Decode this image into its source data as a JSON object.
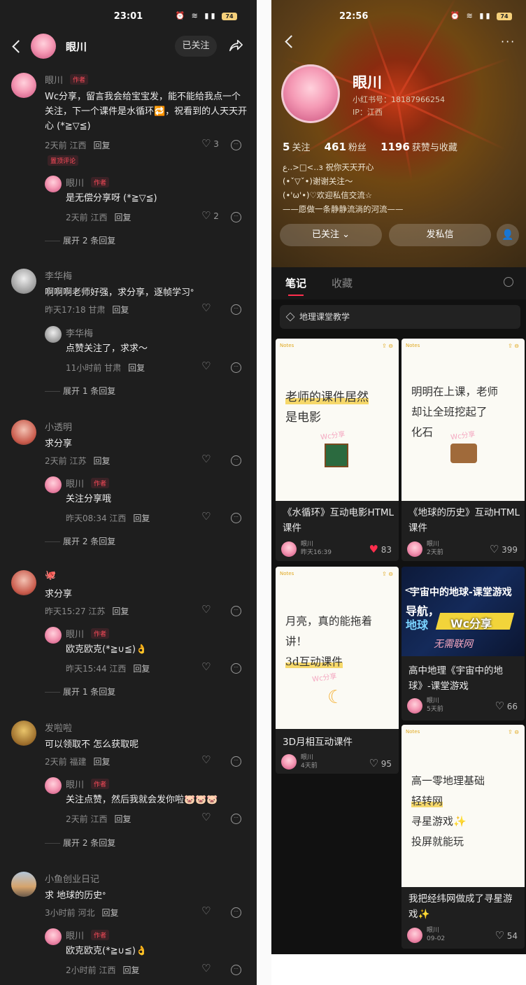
{
  "left": {
    "status": {
      "time": "23:01",
      "battery": "74"
    },
    "header": {
      "name": "眼川",
      "follow": "已关注"
    },
    "comments": [
      {
        "name": "眼川",
        "author_tag": "作者",
        "text": "Wc分享，留言我会给宝宝发，能不能给我点一个关注，下一个课件是水循环🔁，祝看到的人天天开心 (*≧▽≦)",
        "time": "2天前 江西",
        "reply": "回复",
        "likes": "3",
        "pinned": "置顶评论",
        "replies": [
          {
            "name": "眼川",
            "author_tag": "作者",
            "text": "是无偿分享呀 (*≧▽≦)",
            "time": "2天前 江西",
            "reply": "回复",
            "likes": "2"
          }
        ],
        "expand": "展开 2 条回复"
      },
      {
        "name": "李华梅",
        "text": "啊啊啊老师好强，求分享，逐帧学习ᐤ",
        "time": "昨天17:18 甘肃",
        "reply": "回复",
        "likes": "",
        "replies": [
          {
            "name": "李华梅",
            "text": "点赞关注了，求求～",
            "time": "11小时前 甘肃",
            "reply": "回复",
            "likes": ""
          }
        ],
        "expand": "展开 1 条回复"
      },
      {
        "name": "小透明",
        "text": "求分享",
        "time": "2天前 江苏",
        "reply": "回复",
        "likes": "",
        "replies": [
          {
            "name": "眼川",
            "author_tag": "作者",
            "text": "关注分享哦",
            "time": "昨天08:34 江西",
            "reply": "回复",
            "likes": ""
          }
        ],
        "expand": "展开 2 条回复"
      },
      {
        "name": "🐙",
        "text": "求分享",
        "time": "昨天15:27 江苏",
        "reply": "回复",
        "likes": "",
        "replies": [
          {
            "name": "眼川",
            "author_tag": "作者",
            "text": "欧克欧克(*≧∪≦)👌",
            "time": "昨天15:44 江西",
            "reply": "回复",
            "likes": ""
          }
        ],
        "expand": "展开 1 条回复"
      },
      {
        "name": "发啦啦",
        "text": "可以领取不 怎么获取呢",
        "time": "2天前 福建",
        "reply": "回复",
        "likes": "",
        "replies": [
          {
            "name": "眼川",
            "author_tag": "作者",
            "text": "关注点赞，然后我就会发你啦🐷🐷🐷",
            "time": "2天前 江西",
            "reply": "回复",
            "likes": ""
          }
        ],
        "expand": "展开 2 条回复"
      },
      {
        "name": "小鱼创业日记",
        "text": "求 地球的历史ᐤ",
        "time": "3小时前 河北",
        "reply": "回复",
        "likes": "",
        "replies": [
          {
            "name": "眼川",
            "author_tag": "作者",
            "text": "欧克欧克(*≧∪≦)👌",
            "time": "2小时前 江西",
            "reply": "回复",
            "likes": ""
          }
        ]
      }
    ]
  },
  "right": {
    "status": {
      "time": "22:56",
      "battery": "74"
    },
    "profile": {
      "name": "眼川",
      "id": "小红书号：18187966254",
      "ip": "IP：江西",
      "following": "5",
      "following_label": "关注",
      "fans": "461",
      "fans_label": "粉丝",
      "likes": "1196",
      "likes_label": "获赞与收藏",
      "bio": [
        "ع..>□<..з 祝你天天开心",
        "(•ˇ▽ˇ•)谢谢关注～",
        "(•'ω'•)♡欢迎私信交流☆",
        "——愿做一条静静流淌的河流——"
      ],
      "follow_btn": "已关注 ⌄",
      "message_btn": "发私信"
    },
    "tabs": [
      "笔记",
      "收藏"
    ],
    "collection": "地理课堂教学",
    "notes": [
      {
        "title": "《水循环》互动电影HTML课件",
        "author": "眼川",
        "date": "昨天16:39",
        "likes": "83",
        "liked": true,
        "hw": [
          "老师的课件居然",
          "是电影"
        ],
        "mark": "Wc分享"
      },
      {
        "title": "《地球的历史》互动HTML课件",
        "author": "眼川",
        "date": "2天前",
        "likes": "399",
        "hw": [
          "明明在上课，老师",
          "却让全班挖起了",
          "化石"
        ],
        "mark": "Wc分享"
      },
      {
        "title": "3D月相互动课件",
        "author": "眼川",
        "date": "4天前",
        "likes": "95",
        "hw": [
          "月亮，真的能拖着",
          "讲！",
          "3d互动课件"
        ],
        "mark": "Wc分享"
      },
      {
        "title": "高中地理《宇宙中的地球》-课堂游戏",
        "author": "眼川",
        "date": "5天前",
        "likes": "66",
        "game": {
          "title": "宇宙中的地球-课堂游戏",
          "l1": "导航，",
          "l2": "地球",
          "brand": "Wc分享",
          "site": "无需联网"
        }
      },
      {
        "title": "我把经纬网做成了寻星游戏✨",
        "author": "眼川",
        "date": "09-02",
        "likes": "54",
        "hw": [
          "高一零地理基础",
          "轻转网",
          "寻星游戏✨",
          "投屏就能玩"
        ]
      }
    ],
    "notes_label": "Notes"
  }
}
